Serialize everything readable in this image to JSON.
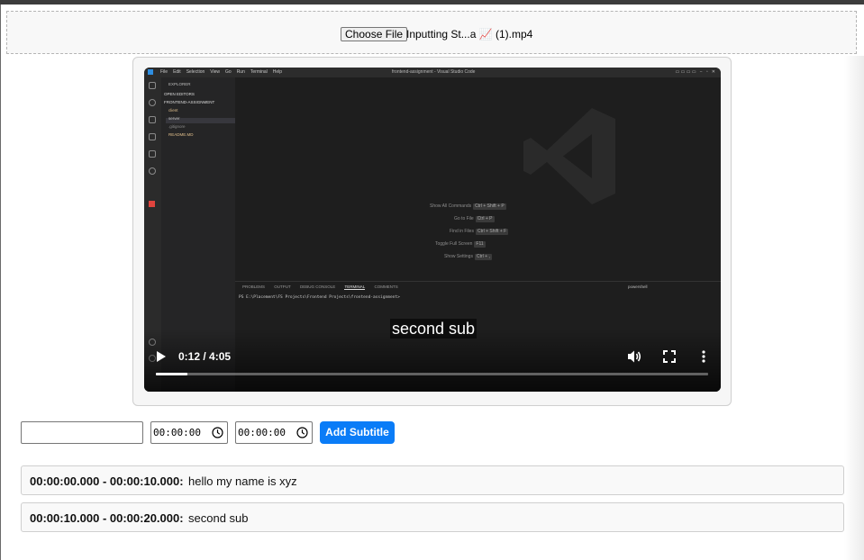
{
  "upload": {
    "button_label": "Choose File",
    "file_name": "Inputting St...a 📈 (1).mp4"
  },
  "video": {
    "caption": "second sub",
    "time_display": "0:12 / 4:05",
    "progress_fraction": 0.057,
    "frame": {
      "window_title": "frontend-assignment - Visual Studio Code",
      "menu": [
        "File",
        "Edit",
        "Selection",
        "View",
        "Go",
        "Run",
        "Terminal",
        "Help"
      ],
      "explorer_title": "EXPLORER",
      "sections": [
        "OPEN EDITORS",
        "FRONTEND-ASSIGNMENT"
      ],
      "tree": [
        "client",
        "server",
        ".gitignore",
        "README.MD"
      ],
      "shortcuts": [
        {
          "label": "Show All Commands",
          "keys": "Ctrl + Shift + P"
        },
        {
          "label": "Go to File",
          "keys": "Ctrl + P"
        },
        {
          "label": "Find in Files",
          "keys": "Ctrl + Shift + F"
        },
        {
          "label": "Toggle Full Screen",
          "keys": "F11"
        },
        {
          "label": "Show Settings",
          "keys": "Ctrl + ,"
        }
      ],
      "panel_tabs": [
        "PROBLEMS",
        "OUTPUT",
        "DEBUG CONSOLE",
        "TERMINAL",
        "COMMENTS"
      ],
      "terminal_shell": "powershell",
      "terminal_line": "PS E:\\Placement\\FS Projects\\Frontend Projects\\frontend-assignment>"
    }
  },
  "form": {
    "subtitle_text_value": "",
    "start_time_value": "00:00:00",
    "end_time_value": "00:00:00",
    "add_button_label": "Add Subtitle"
  },
  "subtitles": [
    {
      "range": "00:00:00.000 - 00:00:10.000:",
      "text": "hello my name is xyz"
    },
    {
      "range": "00:00:10.000 - 00:00:20.000:",
      "text": "second sub"
    }
  ],
  "colors": {
    "accent": "#0a7cf7",
    "video_bg": "#1e1e1e"
  },
  "icons": {
    "play": "play-icon",
    "volume": "volume-icon",
    "fullscreen": "fullscreen-icon",
    "more": "more-vert-icon",
    "clock": "clock-icon"
  }
}
